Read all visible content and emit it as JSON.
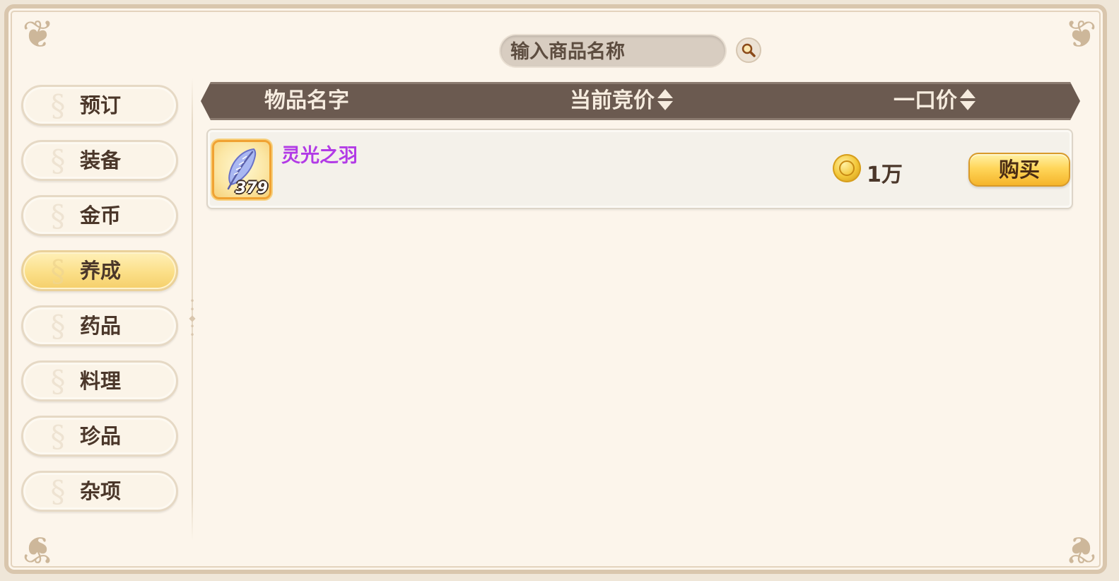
{
  "search": {
    "placeholder": "输入商品名称"
  },
  "sidebar": {
    "items": [
      {
        "label": "预订"
      },
      {
        "label": "装备"
      },
      {
        "label": "金币"
      },
      {
        "label": "养成"
      },
      {
        "label": "药品"
      },
      {
        "label": "料理"
      },
      {
        "label": "珍品"
      },
      {
        "label": "杂项"
      }
    ],
    "active_index": 3
  },
  "table": {
    "headers": {
      "name": "物品名字",
      "bid": "当前竞价",
      "buyout": "一口价"
    },
    "rows": [
      {
        "item_icon": "feather-icon",
        "count": "379",
        "name": "灵光之羽",
        "name_color": "#b23be6",
        "price": "1万",
        "buy_label": "购买"
      }
    ]
  },
  "colors": {
    "header_bg": "#6b5a50",
    "panel_bg": "#fcf5eb",
    "active_tab": "#fbdf88",
    "buy_button": "#ffd65a"
  }
}
